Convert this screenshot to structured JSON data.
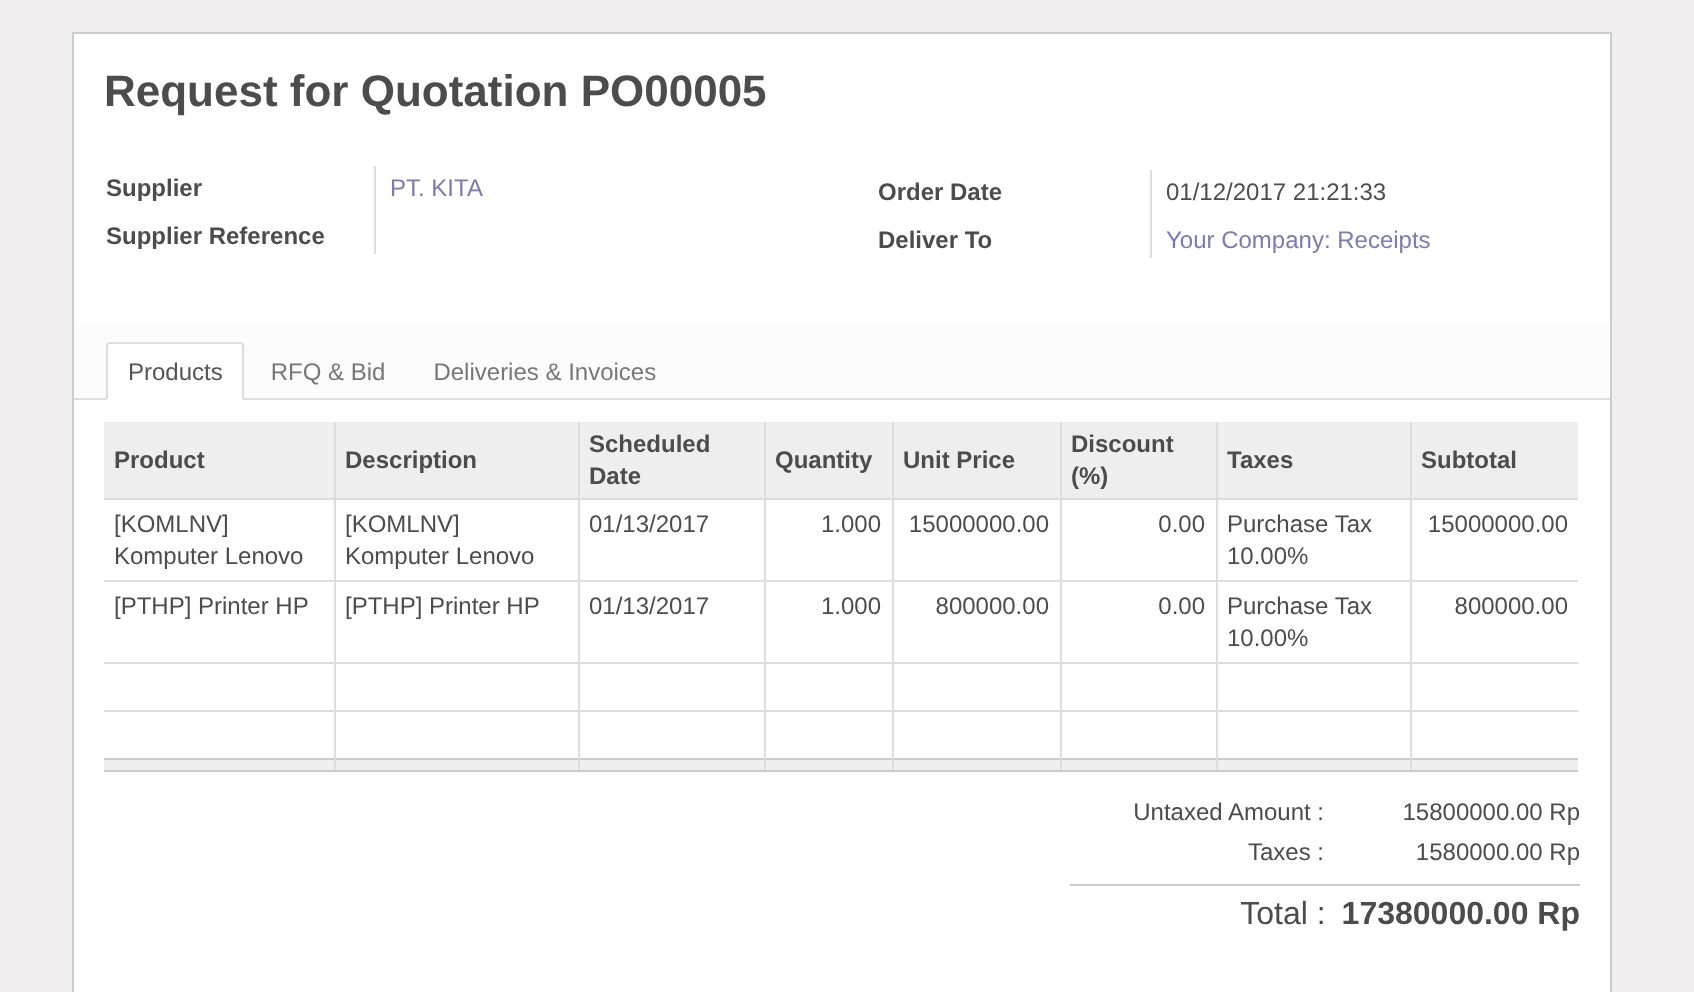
{
  "title": "Request for Quotation PO00005",
  "fields_left": [
    {
      "label": "Supplier",
      "value": "PT. KITA",
      "kind": "link"
    },
    {
      "label": "Supplier Reference"
    }
  ],
  "fields_right": [
    {
      "label": "Order Date",
      "value": "01/12/2017 21:21:33",
      "kind": "text"
    },
    {
      "label": "Deliver To",
      "value": "Your Company: Receipts",
      "kind": "link"
    }
  ],
  "tabs": [
    {
      "label": "Products",
      "selected": true
    },
    {
      "label": "RFQ & Bid",
      "selected": false
    },
    {
      "label": "Deliveries & Invoices",
      "selected": false
    }
  ],
  "table": {
    "columns": [
      "Product",
      "Description",
      "Scheduled Date",
      "Quantity",
      "Unit Price",
      "Discount (%)",
      "Taxes",
      "Subtotal"
    ],
    "rows": [
      [
        "[KOMLNV] Komputer Lenovo",
        "[KOMLNV] Komputer Lenovo",
        "01/13/2017",
        "1.000",
        "15000000.00",
        "0.00",
        "Purchase Tax 10.00%",
        "15000000.00"
      ],
      [
        "[PTHP] Printer HP",
        "[PTHP] Printer HP",
        "01/13/2017",
        "1.000",
        "800000.00",
        "0.00",
        "Purchase Tax 10.00%",
        "800000.00"
      ]
    ]
  },
  "totals": [
    {
      "label": "Untaxed Amount :",
      "value": "15800000.00 Rp"
    },
    {
      "label": "Taxes :",
      "value": "1580000.00 Rp"
    }
  ],
  "total": {
    "label": "Total :",
    "value": "17380000.00 Rp"
  }
}
